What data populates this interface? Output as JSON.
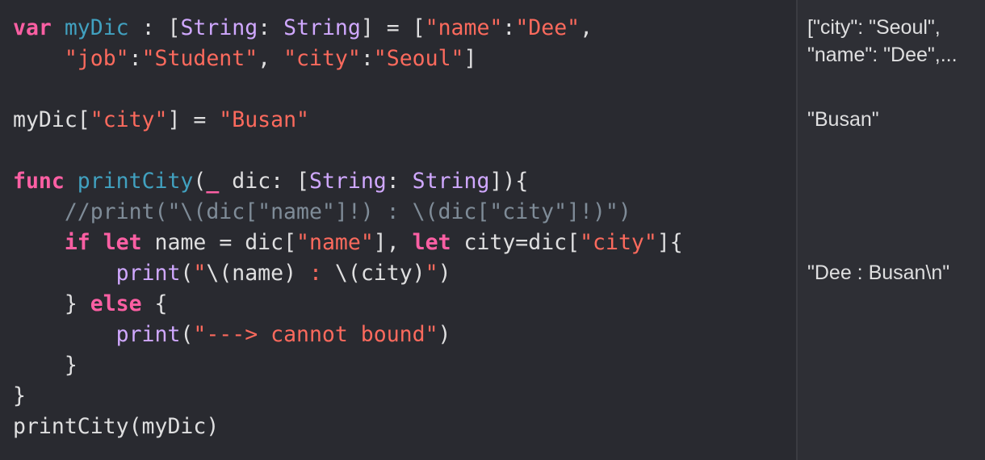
{
  "code": {
    "lines": [
      [
        {
          "t": "var",
          "c": "kw"
        },
        {
          "t": " ",
          "c": "plain"
        },
        {
          "t": "myDic",
          "c": "decl"
        },
        {
          "t": " : [",
          "c": "plain"
        },
        {
          "t": "String",
          "c": "type"
        },
        {
          "t": ": ",
          "c": "plain"
        },
        {
          "t": "String",
          "c": "type"
        },
        {
          "t": "] = [",
          "c": "plain"
        },
        {
          "t": "\"name\"",
          "c": "str"
        },
        {
          "t": ":",
          "c": "plain"
        },
        {
          "t": "\"Dee\"",
          "c": "str"
        },
        {
          "t": ",",
          "c": "plain"
        }
      ],
      [
        {
          "t": "    ",
          "c": "plain"
        },
        {
          "t": "\"job\"",
          "c": "str"
        },
        {
          "t": ":",
          "c": "plain"
        },
        {
          "t": "\"Student\"",
          "c": "str"
        },
        {
          "t": ", ",
          "c": "plain"
        },
        {
          "t": "\"city\"",
          "c": "str"
        },
        {
          "t": ":",
          "c": "plain"
        },
        {
          "t": "\"Seoul\"",
          "c": "str"
        },
        {
          "t": "]",
          "c": "plain"
        }
      ],
      [],
      [
        {
          "t": "myDic[",
          "c": "plain"
        },
        {
          "t": "\"city\"",
          "c": "str"
        },
        {
          "t": "] = ",
          "c": "plain"
        },
        {
          "t": "\"Busan\"",
          "c": "str"
        }
      ],
      [],
      [
        {
          "t": "func",
          "c": "kw"
        },
        {
          "t": " ",
          "c": "plain"
        },
        {
          "t": "printCity",
          "c": "decl"
        },
        {
          "t": "(",
          "c": "plain"
        },
        {
          "t": "_",
          "c": "kw"
        },
        {
          "t": " dic: [",
          "c": "plain"
        },
        {
          "t": "String",
          "c": "type"
        },
        {
          "t": ": ",
          "c": "plain"
        },
        {
          "t": "String",
          "c": "type"
        },
        {
          "t": "]){",
          "c": "plain"
        }
      ],
      [
        {
          "t": "    //print(\"\\(dic[\"name\"]!) : \\(dic[\"city\"]!)\")",
          "c": "cmt"
        }
      ],
      [
        {
          "t": "    ",
          "c": "plain"
        },
        {
          "t": "if",
          "c": "kw"
        },
        {
          "t": " ",
          "c": "plain"
        },
        {
          "t": "let",
          "c": "kw"
        },
        {
          "t": " name = dic[",
          "c": "plain"
        },
        {
          "t": "\"name\"",
          "c": "str"
        },
        {
          "t": "], ",
          "c": "plain"
        },
        {
          "t": "let",
          "c": "kw"
        },
        {
          "t": " city=dic[",
          "c": "plain"
        },
        {
          "t": "\"city\"",
          "c": "str"
        },
        {
          "t": "]{",
          "c": "plain"
        }
      ],
      [
        {
          "t": "        ",
          "c": "plain"
        },
        {
          "t": "print",
          "c": "type"
        },
        {
          "t": "(",
          "c": "plain"
        },
        {
          "t": "\"",
          "c": "str"
        },
        {
          "t": "\\(name)",
          "c": "plain"
        },
        {
          "t": " : ",
          "c": "str"
        },
        {
          "t": "\\(city)",
          "c": "plain"
        },
        {
          "t": "\"",
          "c": "str"
        },
        {
          "t": ")",
          "c": "plain"
        }
      ],
      [
        {
          "t": "    } ",
          "c": "plain"
        },
        {
          "t": "else",
          "c": "kw"
        },
        {
          "t": " {",
          "c": "plain"
        }
      ],
      [
        {
          "t": "        ",
          "c": "plain"
        },
        {
          "t": "print",
          "c": "type"
        },
        {
          "t": "(",
          "c": "plain"
        },
        {
          "t": "\"---> cannot bound\"",
          "c": "str"
        },
        {
          "t": ")",
          "c": "plain"
        }
      ],
      [
        {
          "t": "    }",
          "c": "plain"
        }
      ],
      [
        {
          "t": "}",
          "c": "plain"
        }
      ],
      [
        {
          "t": "printCity(myDic)",
          "c": "plain"
        }
      ]
    ]
  },
  "results": {
    "dict_line1": "[\"city\": \"Seoul\",",
    "dict_line2": "\"name\": \"Dee\",...",
    "busan": "\"Busan\"",
    "print_output": "\"Dee : Busan\\n\""
  },
  "colors": {
    "editor_background": "#292a30",
    "results_background": "#2e2f35",
    "keyword": "#fc5fa3",
    "declaration": "#41a1c0",
    "type": "#d0a8ff",
    "string": "#fc6a5d",
    "plain_text": "#dfdfe0",
    "comment": "#7f8c98"
  }
}
